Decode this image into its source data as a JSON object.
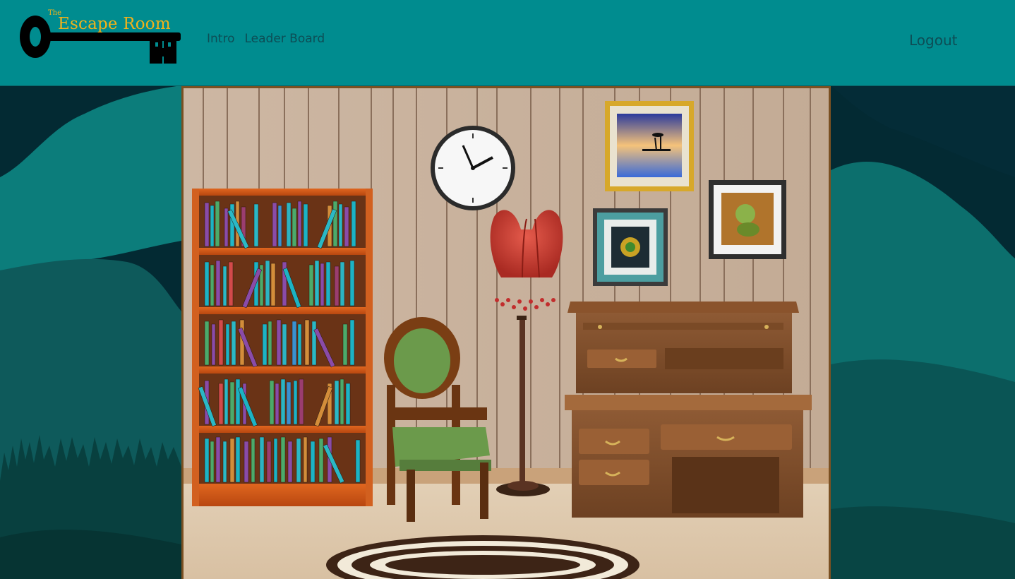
{
  "app": {
    "logo": {
      "small": "The",
      "title": "Escape Room"
    }
  },
  "nav": [
    {
      "label": "Intro"
    },
    {
      "label": "Leader Board"
    }
  ],
  "account": {
    "logout_label": "Logout"
  },
  "colors": {
    "header_bg": "#008c8f",
    "nav_text": "#0d4d55",
    "logo_text": "#f2b21a",
    "room_frame": "#7a5022"
  },
  "room": {
    "objects": [
      {
        "name": "bookshelf-icon"
      },
      {
        "name": "wall-clock-icon"
      },
      {
        "name": "lamp-icon"
      },
      {
        "name": "armchair-icon"
      },
      {
        "name": "roll-top-desk-icon"
      },
      {
        "name": "painting-beach-icon"
      },
      {
        "name": "painting-ornament-icon"
      },
      {
        "name": "painting-creature-icon"
      },
      {
        "name": "rug-icon"
      }
    ]
  }
}
